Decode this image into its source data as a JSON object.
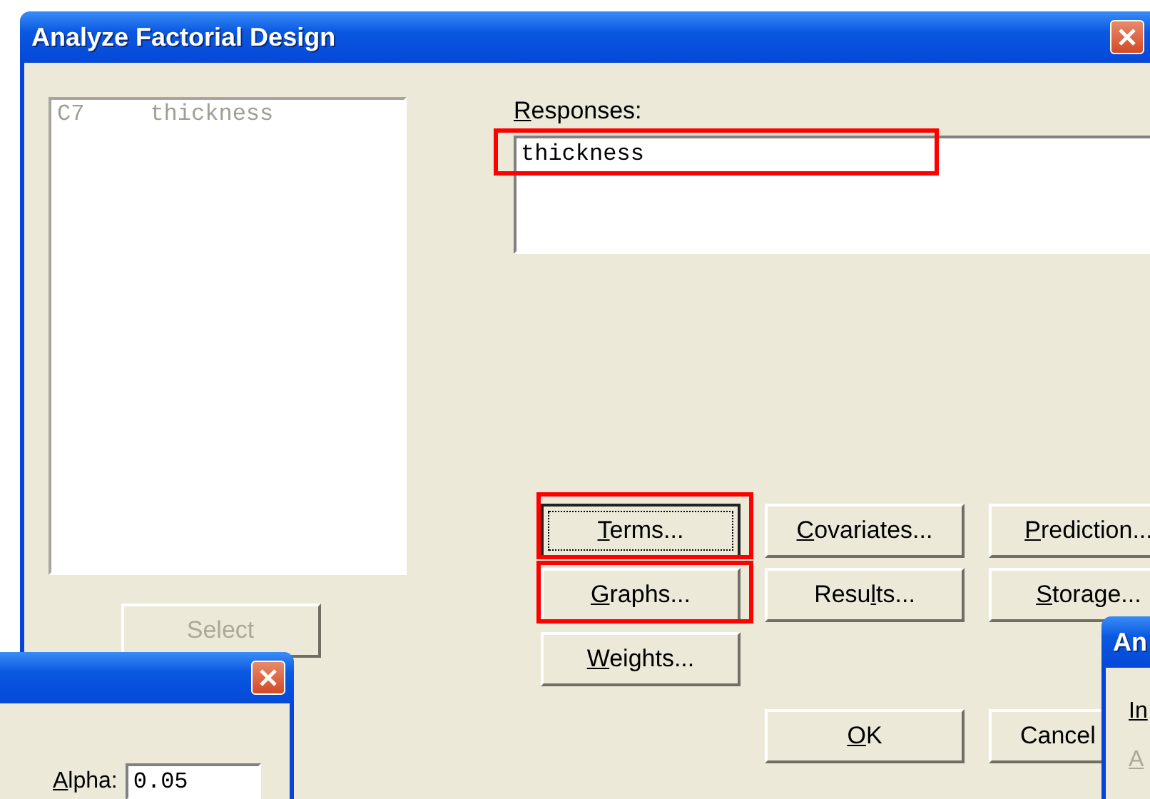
{
  "main_window": {
    "title": "Analyze Factorial Design",
    "columns": [
      {
        "id": "C7",
        "name": "thickness",
        "disabled": true
      }
    ],
    "select_button": {
      "label": {
        "pre": "Select"
      },
      "disabled": true
    },
    "responses": {
      "label": {
        "key": "R",
        "post": "esponses:"
      },
      "value": "thickness",
      "highlighted": true
    },
    "buttons": [
      {
        "label": {
          "key": "T",
          "post": "erms..."
        },
        "focused": true,
        "highlighted": true
      },
      {
        "label": {
          "key": "C",
          "post": "ovariates..."
        },
        "focused": false,
        "highlighted": false
      },
      {
        "label": {
          "key": "P",
          "post": "rediction..."
        },
        "focused": false,
        "highlighted": false
      },
      {
        "label": {
          "key": "G",
          "post": "raphs..."
        },
        "focused": false,
        "highlighted": true
      },
      {
        "label": {
          "pre": "Resu",
          "key": "l",
          "post": "ts..."
        },
        "focused": false,
        "highlighted": false
      },
      {
        "label": {
          "key": "S",
          "post": "torage..."
        },
        "focused": false,
        "highlighted": false
      },
      {
        "label": {
          "key": "W",
          "post": "eights..."
        },
        "focused": false,
        "highlighted": false
      }
    ],
    "ok_button": {
      "key": "O",
      "post": "K"
    },
    "cancel_button": {
      "pre": "Cancel"
    }
  },
  "left_dialog": {
    "alpha_label": {
      "key": "A",
      "post": "lpha:"
    },
    "alpha_value": "0.05"
  },
  "right_dialog": {
    "title": "An",
    "line_1": {
      "key": "In"
    },
    "line_2": {
      "key": "A"
    }
  }
}
